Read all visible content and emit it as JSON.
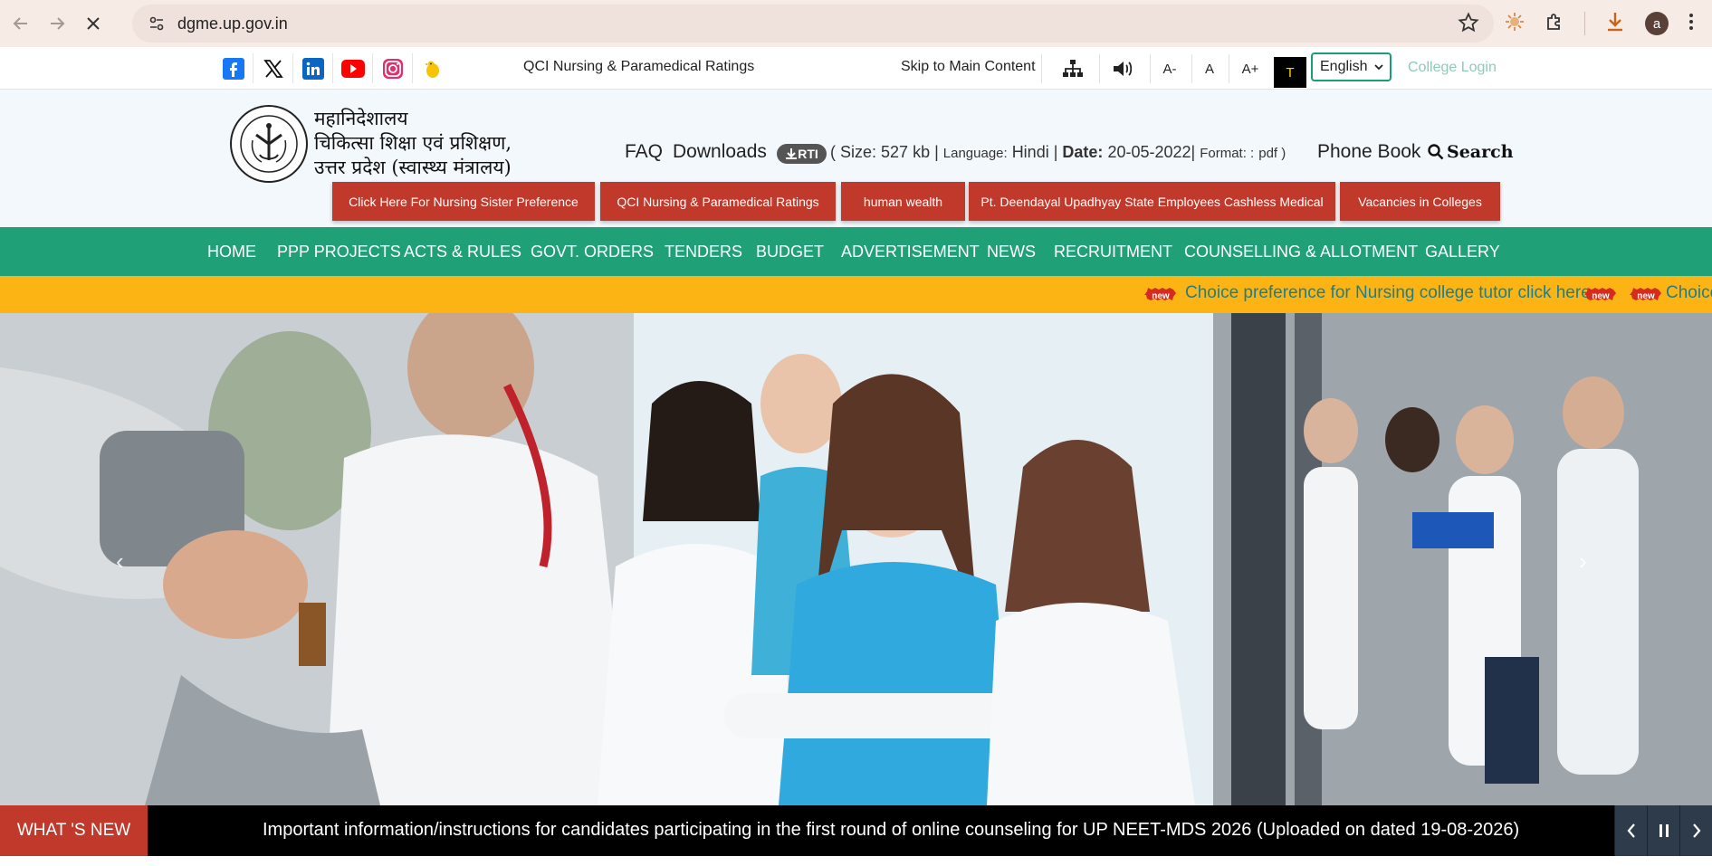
{
  "browser": {
    "url": "dgme.up.gov.in",
    "avatar_letter": "a"
  },
  "utility": {
    "social_icons": [
      "facebook-icon",
      "x-icon",
      "linkedin-icon",
      "youtube-icon",
      "instagram-icon",
      "koo-icon"
    ],
    "qci_link": "QCI Nursing & Paramedical Ratings",
    "skip_link": "Skip to Main Content",
    "font_decrease": "A-",
    "font_normal": "A",
    "font_increase": "A+",
    "contrast": "T",
    "language": "English",
    "college_login": "College Login"
  },
  "header": {
    "dept_line1": "महानिदेशालय",
    "dept_line2": "चिकित्सा शिक्षा एवं प्रशिक्षण,",
    "dept_line3": "उत्तर प्रदेश (स्वास्थ्य मंत्रालय)",
    "faq": "FAQ",
    "downloads": "Downloads",
    "rti": "RTI",
    "rti_meta": {
      "size_label": "( Size:",
      "size": "527 kb",
      "lang_label": "Language:",
      "lang": "Hindi",
      "date_label": "Date:",
      "date": "20-05-2022",
      "format_label": "Format: :",
      "format": "pdf )"
    },
    "phone_book": "Phone Book",
    "search": "Search"
  },
  "quick_buttons": [
    "Click Here For Nursing Sister Preference",
    "QCI Nursing & Paramedical Ratings",
    "human wealth",
    "Pt. Deendayal Upadhyay State Employees Cashless Medical",
    "Vacancies in Colleges"
  ],
  "nav": [
    "HOME",
    "PPP PROJECTS",
    "ACTS & RULES",
    "GOVT. ORDERS",
    "TENDERS",
    "BUDGET",
    "ADVERTISEMENT",
    "NEWS",
    "RECRUITMENT",
    "COUNSELLING & ALLOTMENT",
    "GALLERY"
  ],
  "ticker": {
    "badge": "new",
    "text": "Choice preference for Nursing college tutor click here",
    "text_repeat": "Choice"
  },
  "whats_new": {
    "label": "WHAT 'S NEW",
    "text": "Important information/instructions for candidates participating in the first round of online counseling for UP NEET-MDS 2026 (Uploaded on dated 19-08-2026)"
  },
  "colors": {
    "nav_green": "#1fa077",
    "button_red": "#c0392b",
    "ticker_yellow": "#fcb414",
    "ticker_text": "#1d7e8e"
  }
}
